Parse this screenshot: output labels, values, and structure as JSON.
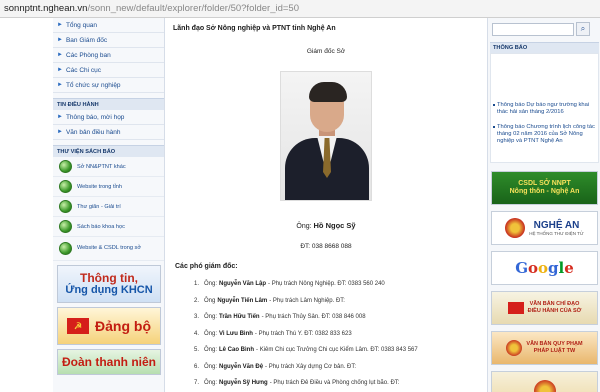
{
  "address_bar": {
    "host": "sonnptnt.nghean.vn",
    "path": "/sonn_new/default/explorer/folder/50?folder_id=50"
  },
  "left_nav": {
    "items": [
      {
        "label": "Tổng quan",
        "icon": "arrow-icon"
      },
      {
        "label": "Ban Giám đốc",
        "icon": "arrow-icon"
      },
      {
        "label": "Các Phòng ban",
        "icon": "arrow-icon"
      },
      {
        "label": "Các Chi cục",
        "icon": "arrow-icon"
      },
      {
        "label": "Tổ chức sự nghiệp",
        "icon": "arrow-icon"
      }
    ],
    "news_section": {
      "title": "TIN ĐIỀU HÀNH",
      "items": [
        {
          "label": "Thông báo, mời họp"
        },
        {
          "label": "Văn bản điều hành"
        }
      ]
    },
    "library_section": {
      "title": "THƯ VIỆN SÁCH BÁO",
      "items": [
        {
          "label": "Sở NN&PTNT khác"
        },
        {
          "label": "Website trong tỉnh"
        },
        {
          "label": "Thư giãn - Giải trí"
        },
        {
          "label": "Sách báo khoa học"
        },
        {
          "label": "Website & CSDL trong sở"
        }
      ]
    },
    "banners": {
      "b1_line1": "Thông tin,",
      "b1_line2": "Ứng dụng KHCN",
      "b2": "Đảng bộ",
      "b3": "Đoàn thanh niên"
    }
  },
  "main": {
    "title": "Lãnh đạo Sở Nông nghiệp và PTNT tỉnh Nghệ An",
    "director_caption": "Giám đốc Sở",
    "director_prefix": "Ông:",
    "director_name": "Hồ Ngọc Sỹ",
    "director_phone": "ĐT: 038 8668 088",
    "deputies_heading": "Các phó giám đốc:",
    "deputies": [
      {
        "num": "1.",
        "prefix": "Ông:",
        "name": "Nguyễn Văn Lập",
        "desc": "- Phụ trách Nông Nghiệp. ĐT: 0383 560 240"
      },
      {
        "num": "2.",
        "prefix": "Ông",
        "name": "Nguyễn Tiến Lâm",
        "desc": "- Phụ trách Lâm Nghiệp. ĐT:"
      },
      {
        "num": "3.",
        "prefix": "Ông:",
        "name": "Trần Hữu Tiến",
        "desc": "- Phụ trách Thủy Sản. ĐT: 038 846 008"
      },
      {
        "num": "4.",
        "prefix": "Ông:",
        "name": "Vi Lưu Bình",
        "desc": "- Phụ trách Thú Y. ĐT: 0382 833 623"
      },
      {
        "num": "5.",
        "prefix": "Ông:",
        "name": "Lê Cao Bình",
        "desc": "- Kiêm Chi cục Trưởng Chi cục Kiểm Lâm. ĐT: 0383 843 567"
      },
      {
        "num": "6.",
        "prefix": "Ông:",
        "name": "Nguyễn Văn Đệ",
        "desc": "- Phụ trách Xây dựng Cơ bản. ĐT:"
      },
      {
        "num": "7.",
        "prefix": "Ông:",
        "name": "Nguyễn Sỹ Hưng",
        "desc": "- Phụ trách Đê Điều và Phòng chống lụt bão. ĐT:"
      }
    ]
  },
  "right": {
    "search_placeholder": "",
    "search_button_icon": "search-icon",
    "notice_heading": "THÔNG BÁO",
    "notices": [
      "Thông báo Dự báo ngư trường khai thác hải sản tháng 2/2016",
      "Thông báo Chương trình lịch công tác tháng 02 năm 2016 của Sở Nông nghiệp và PTNT Nghệ An"
    ],
    "ads": {
      "a1_line1": "CSDL SỞ NNPT",
      "a1_line2": "Nông thôn - Nghệ An",
      "a2_title": "NGHỆ AN",
      "a2_sub": "HỆ THỐNG THƯ ĐIỆN TỬ",
      "a3_letters": [
        "G",
        "o",
        "o",
        "g",
        "l",
        "e"
      ],
      "a4_line1": "VĂN BẢN CHỈ ĐẠO",
      "a4_line2": "ĐIỀU HÀNH CỦA SỞ",
      "a5_line1": "VĂN BẢN QUY PHẠM",
      "a5_line2": "PHÁP LUẬT TW"
    }
  }
}
